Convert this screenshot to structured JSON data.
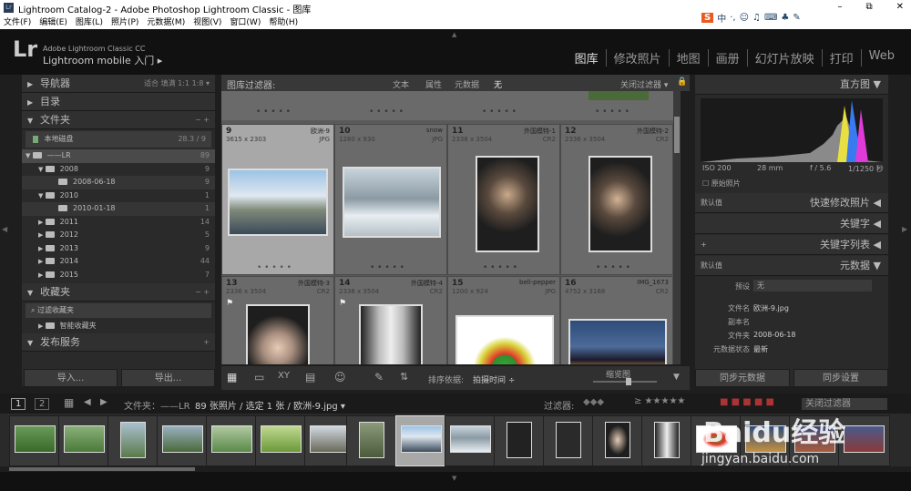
{
  "window": {
    "title": "Lightroom Catalog-2 - Adobe Photoshop Lightroom Classic - 图库",
    "menu": [
      "文件(F)",
      "编辑(E)",
      "图库(L)",
      "照片(P)",
      "元数据(M)",
      "视图(V)",
      "窗口(W)",
      "帮助(H)"
    ],
    "controls": [
      "–",
      "⧉",
      "✕"
    ]
  },
  "ime": {
    "brand": "S",
    "label": "中"
  },
  "identity": {
    "logo": "Lr",
    "line1": "Adobe Lightroom Classic CC",
    "line2": "Lightroom mobile 入门 ▸"
  },
  "modules": [
    "图库",
    "修改照片",
    "地图",
    "画册",
    "幻灯片放映",
    "打印",
    "Web"
  ],
  "left": {
    "navigator": "导航器",
    "nav_opts": "适合  填满  1:1  1:8 ▾",
    "catalog": "目录",
    "folders": "文件夹",
    "volume": {
      "name": "本地磁盘",
      "stat": "28.3 / 9"
    },
    "tree": [
      {
        "label": "——LR",
        "count": "89",
        "level": 0
      },
      {
        "label": "2008",
        "count": "9",
        "level": 1
      },
      {
        "label": "2008-06-18",
        "count": "9",
        "level": 2
      },
      {
        "label": "2010",
        "count": "1",
        "level": 1
      },
      {
        "label": "2010-01-18",
        "count": "1",
        "level": 2
      },
      {
        "label": "2011",
        "count": "14",
        "level": 1
      },
      {
        "label": "2012",
        "count": "5",
        "level": 1
      },
      {
        "label": "2013",
        "count": "9",
        "level": 1
      },
      {
        "label": "2014",
        "count": "44",
        "level": 1
      },
      {
        "label": "2015",
        "count": "7",
        "level": 1
      }
    ],
    "collections": "收藏夹",
    "filter_collections": "过滤收藏夹",
    "smart_collections": "智能收藏夹",
    "publish": "发布服务",
    "import": "导入...",
    "export": "导出..."
  },
  "filterbar": {
    "label": "图库过滤器:",
    "tabs": [
      "文本",
      "属性",
      "元数据",
      "无"
    ],
    "custom": "关闭过滤器 ▾"
  },
  "cells": [
    {
      "num": "9",
      "name": "欧洲-9",
      "dim": "3615 x 2303",
      "ext": "JPG"
    },
    {
      "num": "10",
      "name": "snow",
      "dim": "1280 x 930",
      "ext": "JPG"
    },
    {
      "num": "11",
      "name": "外国模特-1",
      "dim": "2336 x 3504",
      "ext": "CR2"
    },
    {
      "num": "12",
      "name": "外国模特-2",
      "dim": "2336 x 3504",
      "ext": "CR2"
    },
    {
      "num": "13",
      "name": "外国模特-3",
      "dim": "2336 x 3504",
      "ext": "CR2"
    },
    {
      "num": "14",
      "name": "外国模特-4",
      "dim": "2336 x 3504",
      "ext": "CR2"
    },
    {
      "num": "15",
      "name": "bell-pepper",
      "dim": "1200 x 924",
      "ext": "JPG"
    },
    {
      "num": "16",
      "name": "IMG_1673",
      "dim": "4752 x 3168",
      "ext": "CR2"
    }
  ],
  "toolbar": {
    "sort_label": "排序依据:",
    "sort_value": "拍摄时间 ÷",
    "thumb_label": "缩览图"
  },
  "right": {
    "histogram": "直方图",
    "iso": "ISO 200",
    "focal": "28 mm",
    "aperture": "f / 5.6",
    "shutter": "1/1250 秒",
    "original": "原始照片",
    "preset_default": "默认值",
    "quick_develop": "快速修改照片",
    "keywords": "关键字",
    "keyword_list": "关键字列表",
    "metadata": "元数据",
    "meta": [
      {
        "k": "预设",
        "v": "无"
      },
      {
        "k": "文件名",
        "v": "欧洲-9.jpg"
      },
      {
        "k": "副本名",
        "v": ""
      },
      {
        "k": "文件夹",
        "v": "2008-06-18"
      },
      {
        "k": "元数据状态",
        "v": "最新"
      }
    ],
    "sync_meta": "同步元数据",
    "sync_settings": "同步设置"
  },
  "filmbar": {
    "pages": [
      "1",
      "2"
    ],
    "path": "文件夹：——LR",
    "count": "89 张照片 / 选定 1 张 / 欧洲-9.jpg ▾",
    "filter_label": "过滤器:",
    "filter_off": "关闭过滤器"
  },
  "watermark": {
    "brand": "Baidu经验",
    "url": "jingyan.baidu.com"
  },
  "colors": {
    "bg": "#1e1e1e",
    "grid": "#5a5a5a",
    "cell": "#6a6a6a",
    "selected": "#a8a8a8"
  }
}
